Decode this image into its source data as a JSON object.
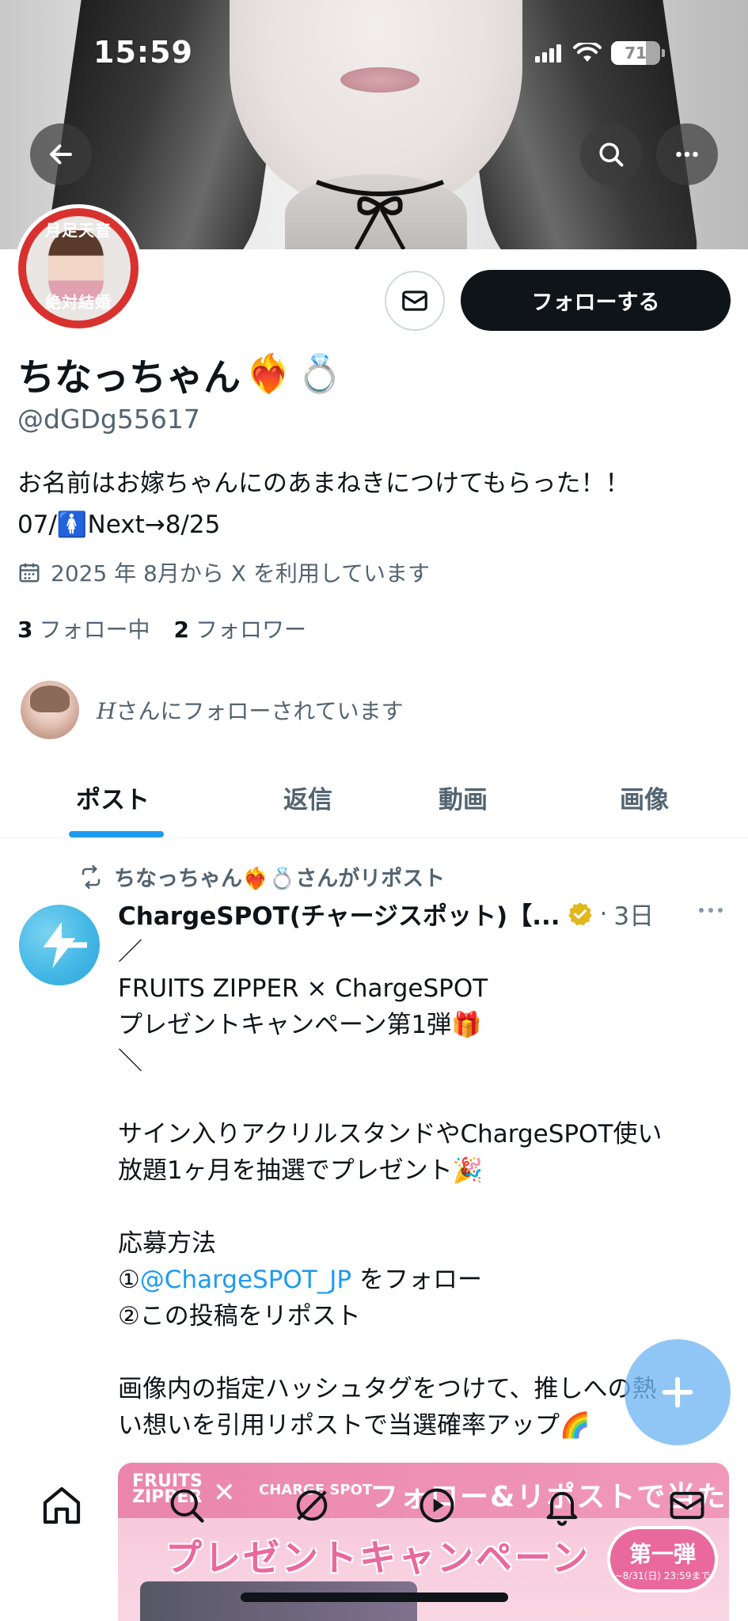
{
  "status_bar": {
    "time": "15:59",
    "battery": "71",
    "battery_level_percent": 71
  },
  "banner": {
    "back_icon": "arrow-left-icon",
    "search_icon": "search-icon",
    "more_icon": "more-horizontal-icon"
  },
  "profile": {
    "avatar_text_top": "月足天音",
    "avatar_text_bottom": "絶対結婚",
    "message_icon": "mail-icon",
    "follow_label": "フォローする",
    "display_name": "ちなっちゃん",
    "name_emojis": [
      "❤️‍🔥",
      "💍"
    ],
    "handle": "@dGDg55617",
    "bio_line1": "お名前はお嫁ちゃんにのあまねきにつけてもらった！！",
    "bio_line2_prefix": "07/",
    "bio_line2_emoji": "🚺",
    "bio_line2_suffix": " Next→8/25",
    "joined_icon": "calendar-icon",
    "joined": "2025 年 8月から X を利用しています",
    "following_count": "3",
    "following_label": "フォロー中",
    "followers_count": "2",
    "followers_label": "フォロワー",
    "followed_by_name": "H",
    "followed_by_text": "さんにフォローされています"
  },
  "tabs": [
    {
      "label": "ポスト",
      "active": true
    },
    {
      "label": "返信",
      "active": false
    },
    {
      "label": "動画",
      "active": false
    },
    {
      "label": "画像",
      "active": false
    }
  ],
  "post": {
    "repost_icon": "repost-icon",
    "repost_by": "ちなっちゃん❤️‍🔥💍さんがリポスト",
    "author": "ChargeSPOT(チャージスポット)【...",
    "verified_icon": "verified-badge-icon",
    "time": "3日",
    "more_icon": "more-horizontal-icon",
    "lines": [
      "／",
      "FRUITS ZIPPER × ChargeSPOT",
      "プレゼントキャンペーン第1弾🎁",
      "＼",
      "",
      "サイン入りアクリルスタンドやChargeSPOT使い",
      "放題1ヶ月を抽選でプレゼント🎉",
      "",
      "応募方法",
      "①",
      "②この投稿をリポスト",
      "",
      "画像内の指定ハッシュタグをつけて、推しへの熱",
      "い想いを引用リポストで当選確率アップ🌈"
    ],
    "mention": "@ChargeSPOT_JP",
    "mention_suffix": " をフォロー"
  },
  "promo_image": {
    "logo1": "FRUITS ZIPPER",
    "logo2": "CHARGE SPOT",
    "headline": "フォロー&リポストで当たる",
    "main": "プレゼントキャンペーン",
    "badge_main": "第一弾",
    "badge_sub": "~8/31(日) 23:59まで"
  },
  "fab": {
    "icon": "compose-post-icon"
  },
  "bottom_nav": [
    {
      "icon": "home-icon"
    },
    {
      "icon": "search-icon"
    },
    {
      "icon": "grok-icon"
    },
    {
      "icon": "play-icon"
    },
    {
      "icon": "bell-icon"
    },
    {
      "icon": "mail-icon"
    }
  ],
  "colors": {
    "accent": "#1d9bf0",
    "text": "#0f1419",
    "secondary": "#536471",
    "follow_button": "#0f1419"
  }
}
